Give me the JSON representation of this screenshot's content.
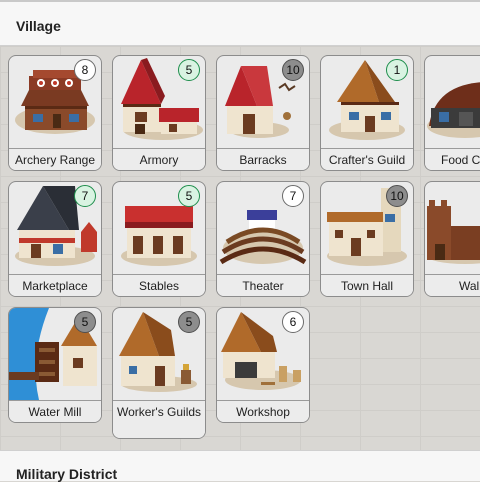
{
  "sections": {
    "village_title": "Village",
    "military_title": "Military District"
  },
  "buildings": [
    {
      "name": "Archery Range",
      "count": "8",
      "badge": "white"
    },
    {
      "name": "Armory",
      "count": "5",
      "badge": "green"
    },
    {
      "name": "Barracks",
      "count": "10",
      "badge": "gray"
    },
    {
      "name": "Crafter's Guild",
      "count": "1",
      "badge": "green"
    },
    {
      "name": "Food C",
      "count": "",
      "badge": "none"
    },
    {
      "name": "Marketplace",
      "count": "7",
      "badge": "green"
    },
    {
      "name": "Stables",
      "count": "5",
      "badge": "green"
    },
    {
      "name": "Theater",
      "count": "7",
      "badge": "white"
    },
    {
      "name": "Town Hall",
      "count": "10",
      "badge": "gray"
    },
    {
      "name": "Wall",
      "count": "",
      "badge": "none"
    },
    {
      "name": "Water Mill",
      "count": "5",
      "badge": "gray"
    },
    {
      "name": "Worker's Guilds",
      "count": "5",
      "badge": "gray"
    },
    {
      "name": "Workshop",
      "count": "6",
      "badge": "white"
    }
  ],
  "colors": {
    "badge_green_border": "#1e8e4c",
    "badge_green_fill": "#d9f3e2",
    "badge_gray_fill": "#8d8d8d",
    "badge_white_fill": "#ffffff"
  }
}
